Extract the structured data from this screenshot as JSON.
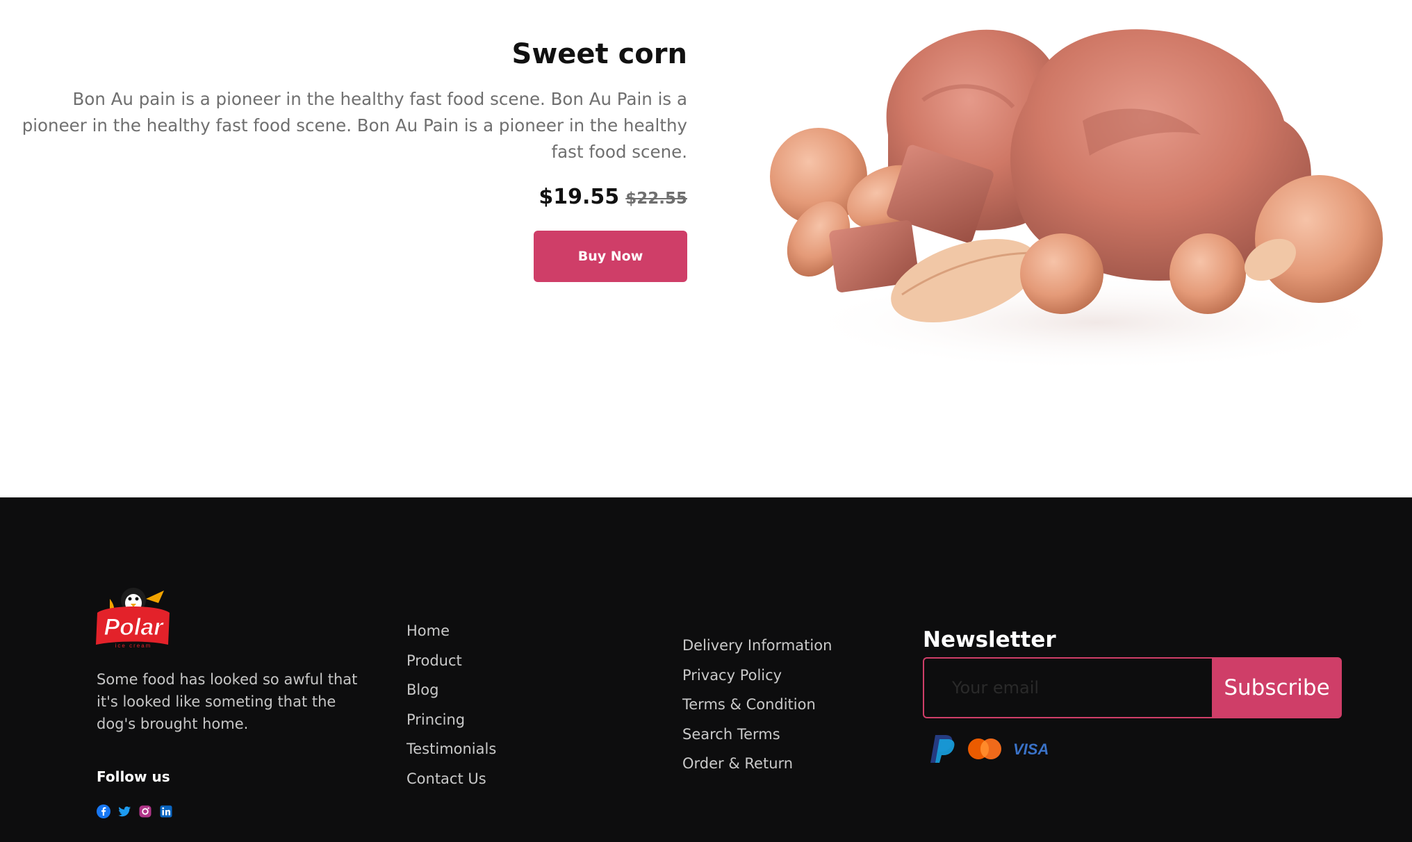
{
  "product": {
    "title": "Sweet corn",
    "description": "Bon Au pain is a pioneer in the healthy fast food scene. Bon Au Pain is a pioneer in the healthy fast food scene. Bon Au Pain is a pioneer in the healthy fast food scene.",
    "price": "$19.55",
    "old_price": "$22.55",
    "buy_label": "Buy Now",
    "image_icon": "ice-cream-scoops-with-nuts-image"
  },
  "footer": {
    "logo_icon": "polar-ice-cream-logo",
    "logo_text": "Polar",
    "logo_subtext": "ice cream",
    "about": "Some food has looked so awful that it's looked like someting that the dog's brought home.",
    "follow_label": "Follow us",
    "socials": [
      {
        "icon": "facebook-icon",
        "color": "#1877f2"
      },
      {
        "icon": "twitter-icon",
        "color": "#1d9bf0"
      },
      {
        "icon": "instagram-icon",
        "color": "#b13589"
      },
      {
        "icon": "linkedin-icon",
        "color": "#0a66c2"
      }
    ],
    "links_col1": [
      "Home",
      "Product",
      "Blog",
      "Princing",
      "Testimonials",
      "Contact Us"
    ],
    "links_col2": [
      "Delivery Information",
      "Privacy Policy",
      "Terms & Condition",
      "Search Terms",
      "Order & Return"
    ],
    "newsletter": {
      "title": "Newsletter",
      "placeholder": "Your email",
      "button": "Subscribe"
    },
    "payments": [
      "paypal-icon",
      "mastercard-icon",
      "visa-icon"
    ],
    "visa_text": "VISA"
  },
  "colors": {
    "accent": "#cf3e68",
    "footer_bg": "#0d0d0e"
  }
}
